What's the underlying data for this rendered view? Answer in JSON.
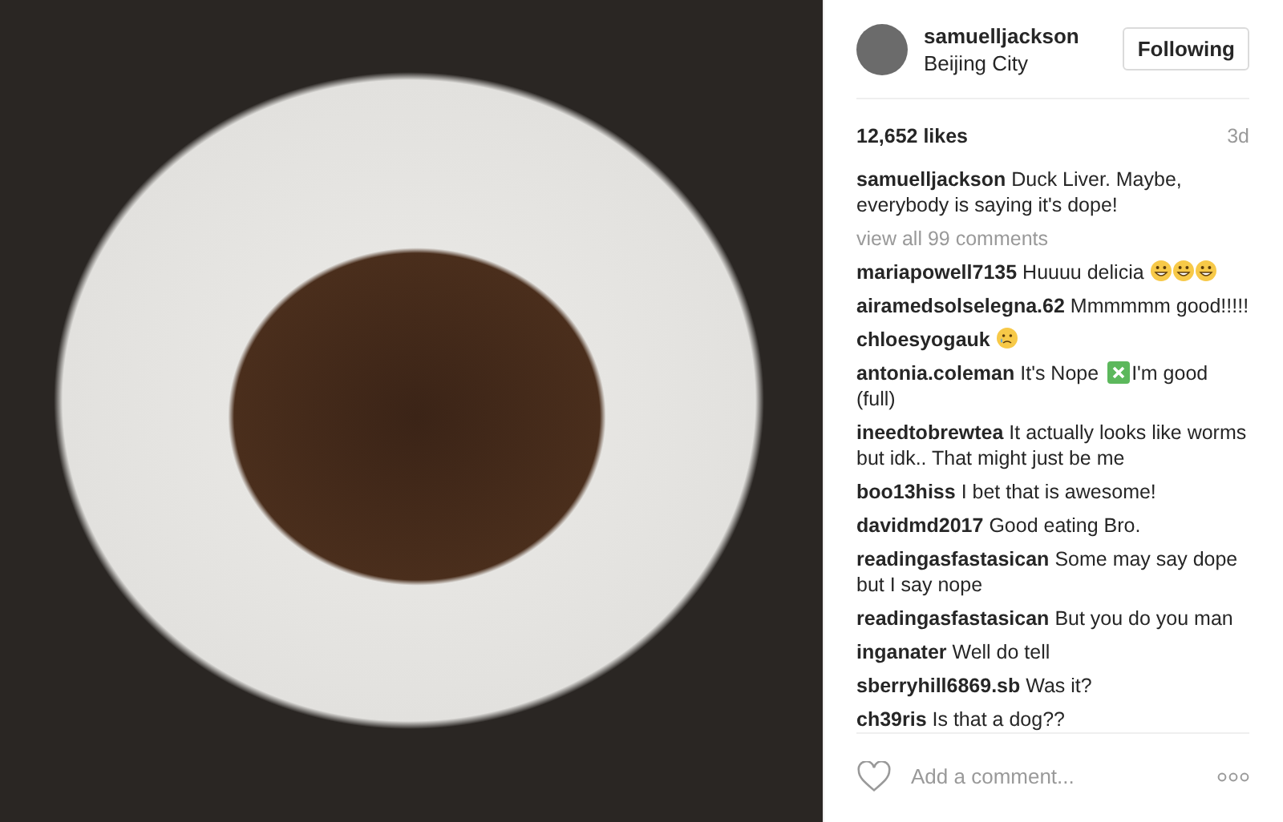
{
  "post": {
    "username": "samuelljackson",
    "location": "Beijing City",
    "follow_button": "Following",
    "likes": "12,652 likes",
    "age": "3d",
    "caption": {
      "username": "samuelljackson",
      "text": "Duck Liver. Maybe, everybody is saying it's dope!"
    },
    "view_all": "view all 99 comments",
    "comments": [
      {
        "username": "mariapowell7135",
        "parts": [
          {
            "kind": "text",
            "text": "Huuuu delicia"
          },
          {
            "kind": "grin"
          },
          {
            "kind": "grin"
          },
          {
            "kind": "grin"
          }
        ]
      },
      {
        "username": "airamedsolselegna.62",
        "parts": [
          {
            "kind": "text",
            "text": "Mmmmmm good!!!!!"
          }
        ]
      },
      {
        "username": "chloesyogauk",
        "parts": [
          {
            "kind": "tear"
          }
        ]
      },
      {
        "username": "antonia.coleman",
        "parts": [
          {
            "kind": "text",
            "text": "It's Nope"
          },
          {
            "kind": "cross"
          },
          {
            "kind": "text",
            "text": "I'm good (full)"
          }
        ]
      },
      {
        "username": "ineedtobrewtea",
        "parts": [
          {
            "kind": "text",
            "text": "It actually looks like worms but idk.. That might just be me"
          }
        ]
      },
      {
        "username": "boo13hiss",
        "parts": [
          {
            "kind": "text",
            "text": "I bet that is awesome!"
          }
        ]
      },
      {
        "username": "davidmd2017",
        "parts": [
          {
            "kind": "text",
            "text": "Good eating Bro."
          }
        ]
      },
      {
        "username": "readingasfastasican",
        "parts": [
          {
            "kind": "text",
            "text": "Some may say dope but I say nope"
          }
        ]
      },
      {
        "username": "readingasfastasican",
        "parts": [
          {
            "kind": "text",
            "text": "But you do you man"
          }
        ]
      },
      {
        "username": "inganater",
        "parts": [
          {
            "kind": "text",
            "text": "Well do tell"
          }
        ]
      },
      {
        "username": "sberryhill6869.sb",
        "parts": [
          {
            "kind": "text",
            "text": "Was it?"
          }
        ]
      },
      {
        "username": "ch39ris",
        "parts": [
          {
            "kind": "text",
            "text": "Is that a dog??"
          }
        ]
      }
    ],
    "comment_placeholder": "Add a comment..."
  }
}
